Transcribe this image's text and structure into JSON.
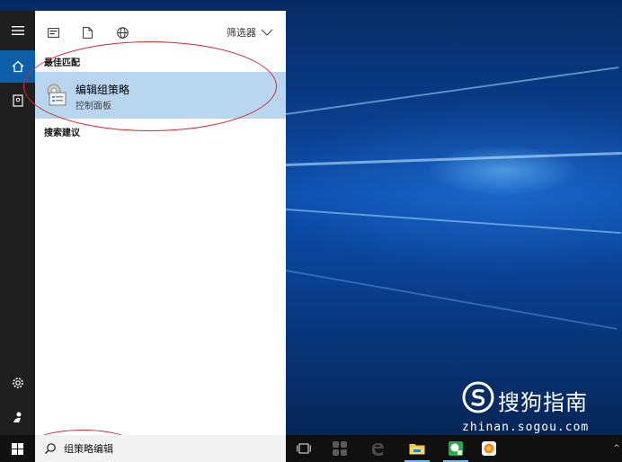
{
  "search_panel": {
    "toolbar": {
      "icons": [
        "apps-icon",
        "document-icon",
        "globe-icon"
      ],
      "filters_label": "筛选器"
    },
    "best_match_heading": "最佳匹配",
    "best_match": {
      "title": "编辑组策略",
      "subtitle": "控制面板",
      "icon": "group-policy-icon"
    },
    "suggestions_heading": "搜索建议"
  },
  "left_rail": {
    "items": [
      "hamburger-menu-icon",
      "home-icon",
      "notebook-icon",
      "settings-icon",
      "feedback-icon"
    ],
    "active": "home-icon"
  },
  "taskbar": {
    "search_query": "组策略编辑",
    "apps": [
      "task-view-icon",
      "app-grey-icon",
      "edge-icon",
      "file-explorer-icon",
      "green-app-icon",
      "orange-app-icon"
    ],
    "tray_chevron": "^"
  },
  "watermark": {
    "brand": "搜狗指南",
    "url": "zhinan.sogou.com"
  },
  "colors": {
    "accent": "#0f5fa8",
    "selected_row": "#b8d6f0",
    "annotation": "#d7262e",
    "taskbar": "#101010"
  }
}
